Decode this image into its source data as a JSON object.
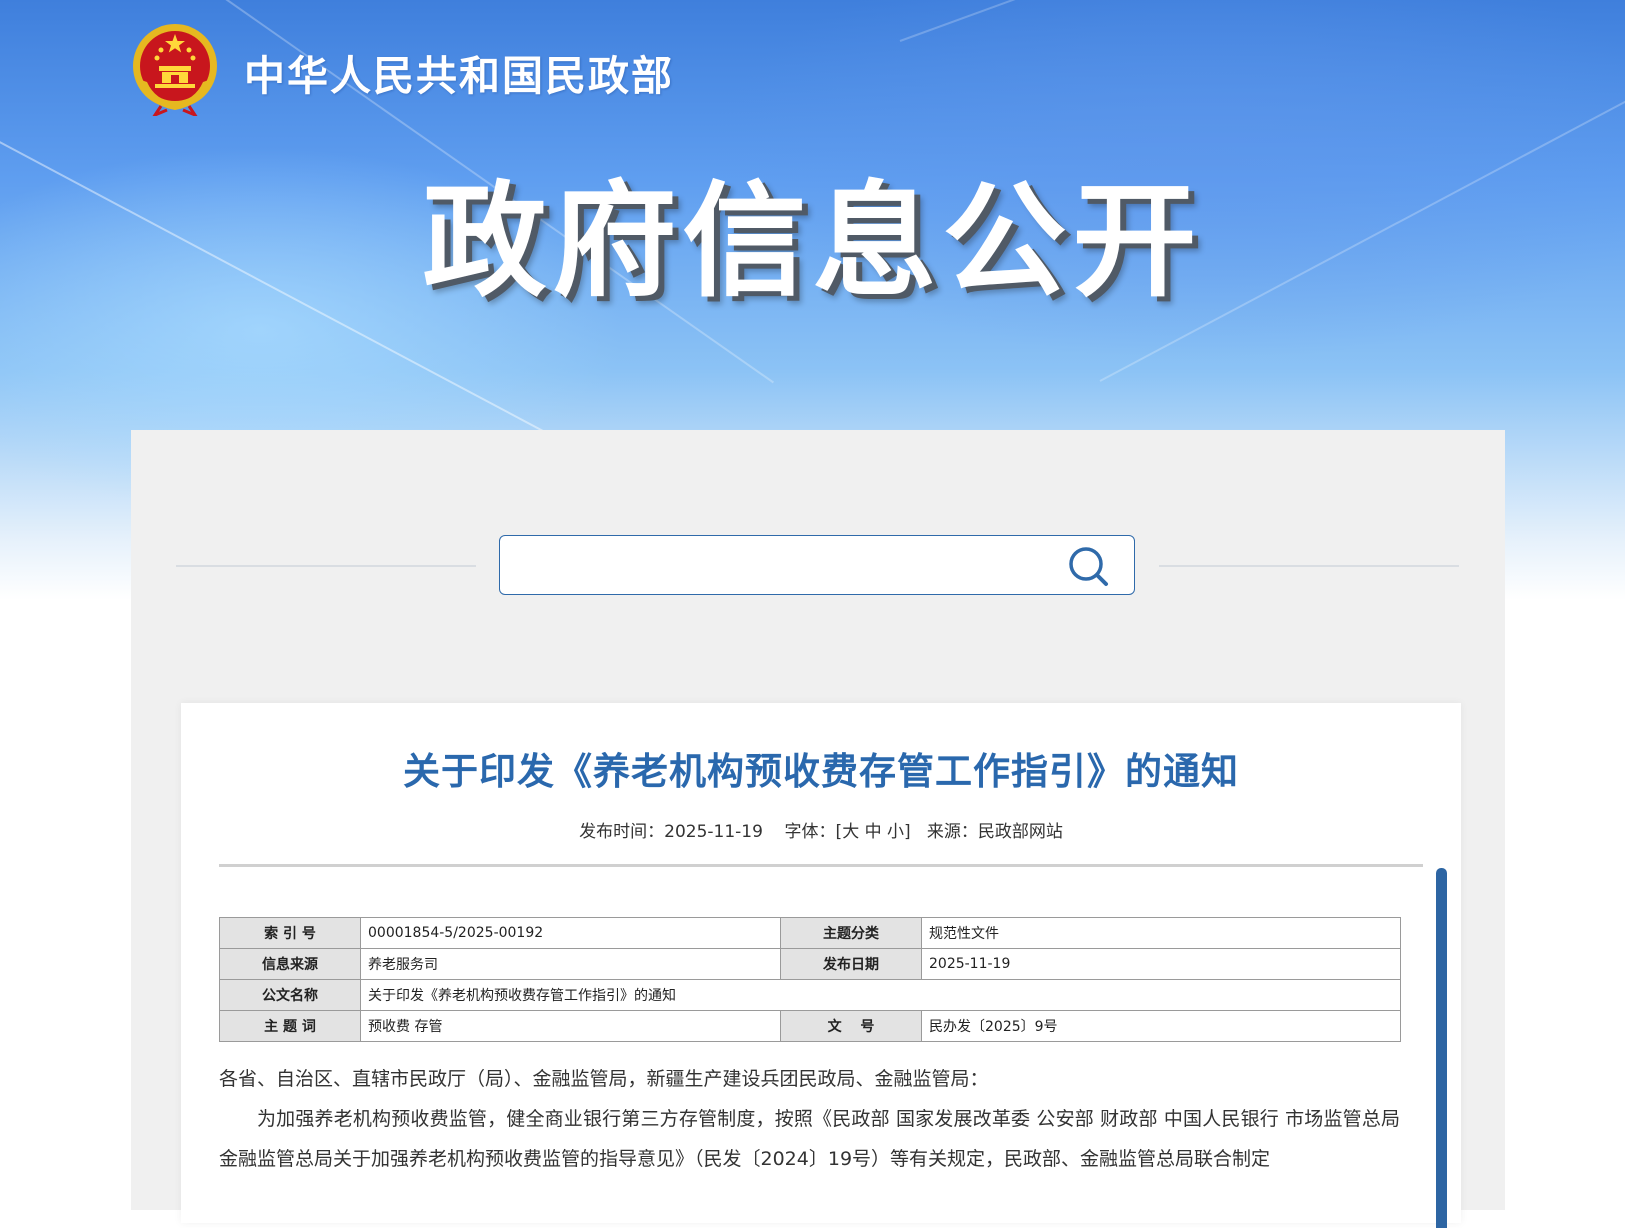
{
  "header": {
    "ministry_name": "中华人民共和国民政部",
    "banner_title": "政府信息公开"
  },
  "search": {
    "value": "",
    "placeholder": ""
  },
  "article": {
    "title": "关于印发《养老机构预收费存管工作指引》的通知",
    "meta": {
      "publish_label": "发布时间：",
      "publish_date": "2025-11-19",
      "font_label": "字体：",
      "font_open": "[",
      "font_large": "大",
      "font_medium": "中",
      "font_small": "小",
      "font_close": "]",
      "source_label": "来源：",
      "source_value": "民政部网站"
    },
    "info_table": {
      "index_label": "索 引 号",
      "index_value": "00001854-5/2025-00192",
      "category_label": "主题分类",
      "category_value": "规范性文件",
      "source_label": "信息来源",
      "source_value": "养老服务司",
      "date_label": "发布日期",
      "date_value": "2025-11-19",
      "doc_name_label": "公文名称",
      "doc_name_value": "关于印发《养老机构预收费存管工作指引》的通知",
      "keywords_label": "主 题 词",
      "keywords_value": "预收费 存管",
      "doc_no_label": "文　 号",
      "doc_no_value": "民办发〔2025〕9号"
    },
    "body": {
      "salutation": "各省、自治区、直辖市民政厅（局）、金融监管局，新疆生产建设兵团民政局、金融监管局：",
      "paragraph1": "为加强养老机构预收费监管，健全商业银行第三方存管制度，按照《民政部 国家发展改革委 公安部 财政部 中国人民银行 市场监管总局 金融监管总局关于加强养老机构预收费监管的指导意见》（民发〔2024〕19号）等有关规定，民政部、金融监管总局联合制定"
    }
  },
  "colors": {
    "title_blue": "#2a68ad",
    "accent_blue": "#2d65a3",
    "panel_gray": "#f0f0f0"
  },
  "icons": {
    "emblem": "national-emblem-icon",
    "search": "search-icon"
  }
}
